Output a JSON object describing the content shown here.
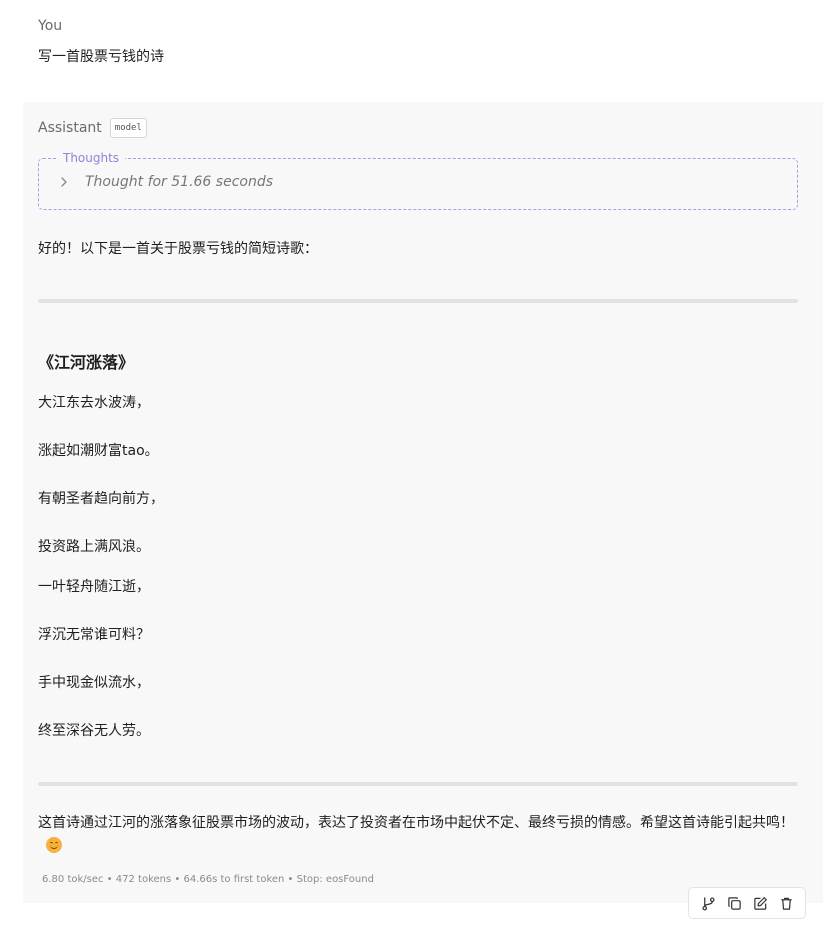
{
  "user": {
    "role": "You",
    "message": "写一首股票亏钱的诗"
  },
  "assistant": {
    "role": "Assistant",
    "model_badge": "model",
    "thoughts": {
      "legend": "Thoughts",
      "summary": "Thought for 51.66 seconds"
    },
    "intro": "好的！以下是一首关于股票亏钱的简短诗歌：",
    "poem": {
      "title": "《江河涨落》",
      "lines": [
        "大江东去水波涛，",
        "涨起如潮财富tao。",
        "有朝圣者趋向前方，",
        "投资路上满风浪。",
        "一叶轻舟随江逝，",
        "浮沉无常谁可料？",
        "手中现金似流水，",
        "终至深谷无人劳。"
      ]
    },
    "summary": "这首诗通过江河的涨落象征股票市场的波动，表达了投资者在市场中起伏不定、最终亏损的情感。希望这首诗能引起共鸣！",
    "stats": "6.80 tok/sec • 472 tokens • 64.66s to first token • Stop: eosFound"
  },
  "actions": [
    {
      "name": "branch-icon"
    },
    {
      "name": "copy-icon"
    },
    {
      "name": "edit-icon"
    },
    {
      "name": "trash-icon"
    }
  ],
  "colors": {
    "thoughts_border": "#a99be6",
    "panel_bg": "#f8f8f9",
    "emoji": "#f6b23a"
  }
}
